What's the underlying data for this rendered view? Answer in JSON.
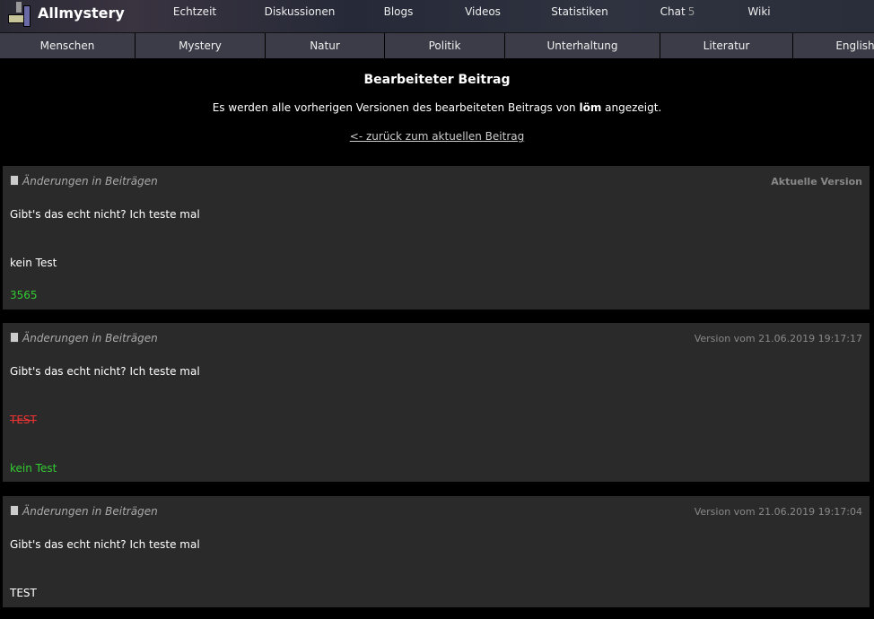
{
  "header": {
    "brand": "Allmystery",
    "nav": [
      "Echtzeit",
      "Diskussionen",
      "Blogs",
      "Videos",
      "Statistiken",
      "Chat",
      "Wiki"
    ],
    "chat_count": "5"
  },
  "subnav": [
    "Menschen",
    "Mystery",
    "Natur",
    "Politik",
    "Unterhaltung",
    "Literatur",
    "English"
  ],
  "page": {
    "title": "Bearbeiteter Beitrag",
    "intro_pre": "Es werden alle vorherigen Versionen des bearbeiteten Beitrags von ",
    "author": "löm",
    "intro_post": " angezeigt.",
    "back": "<- zurück zum aktuellen Beitrag"
  },
  "versions": [
    {
      "title": "Änderungen in Beiträgen",
      "label": "Aktuelle Version",
      "lines": [
        "Gibt's das echt nicht? Ich teste mal",
        "kein Test",
        "3565"
      ]
    },
    {
      "title": "Änderungen in Beiträgen",
      "label": "Version vom 21.06.2019 19:17:17",
      "lines": [
        "Gibt's das echt nicht? Ich teste mal",
        "TEST",
        "kein Test"
      ]
    },
    {
      "title": "Änderungen in Beiträgen",
      "label": "Version vom 21.06.2019 19:17:04",
      "lines": [
        "Gibt's das echt nicht? Ich teste mal",
        "TEST"
      ]
    }
  ],
  "colors": {
    "added": "#33cc33",
    "removed": "#ee3333",
    "card": "#2a2a2a"
  }
}
